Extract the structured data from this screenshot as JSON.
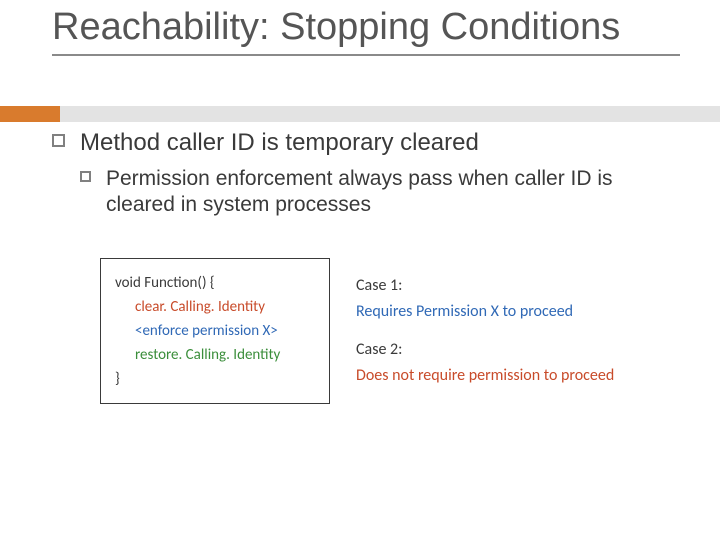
{
  "title": "Reachability: Stopping Conditions",
  "bullets": {
    "main": "Method caller ID is temporary cleared",
    "sub": "Permission enforcement always pass when caller ID is cleared in system processes"
  },
  "code": {
    "sig": "void Function() {",
    "clear": "clear. Calling. Identity",
    "enforce": "<enforce permission X>",
    "restore": "restore. Calling. Identity",
    "close": "}"
  },
  "cases": {
    "c1": "Case 1:",
    "c1n": "Requires Permission X to proceed",
    "c2": "Case 2:",
    "c2n": "Does not require permission to proceed"
  }
}
